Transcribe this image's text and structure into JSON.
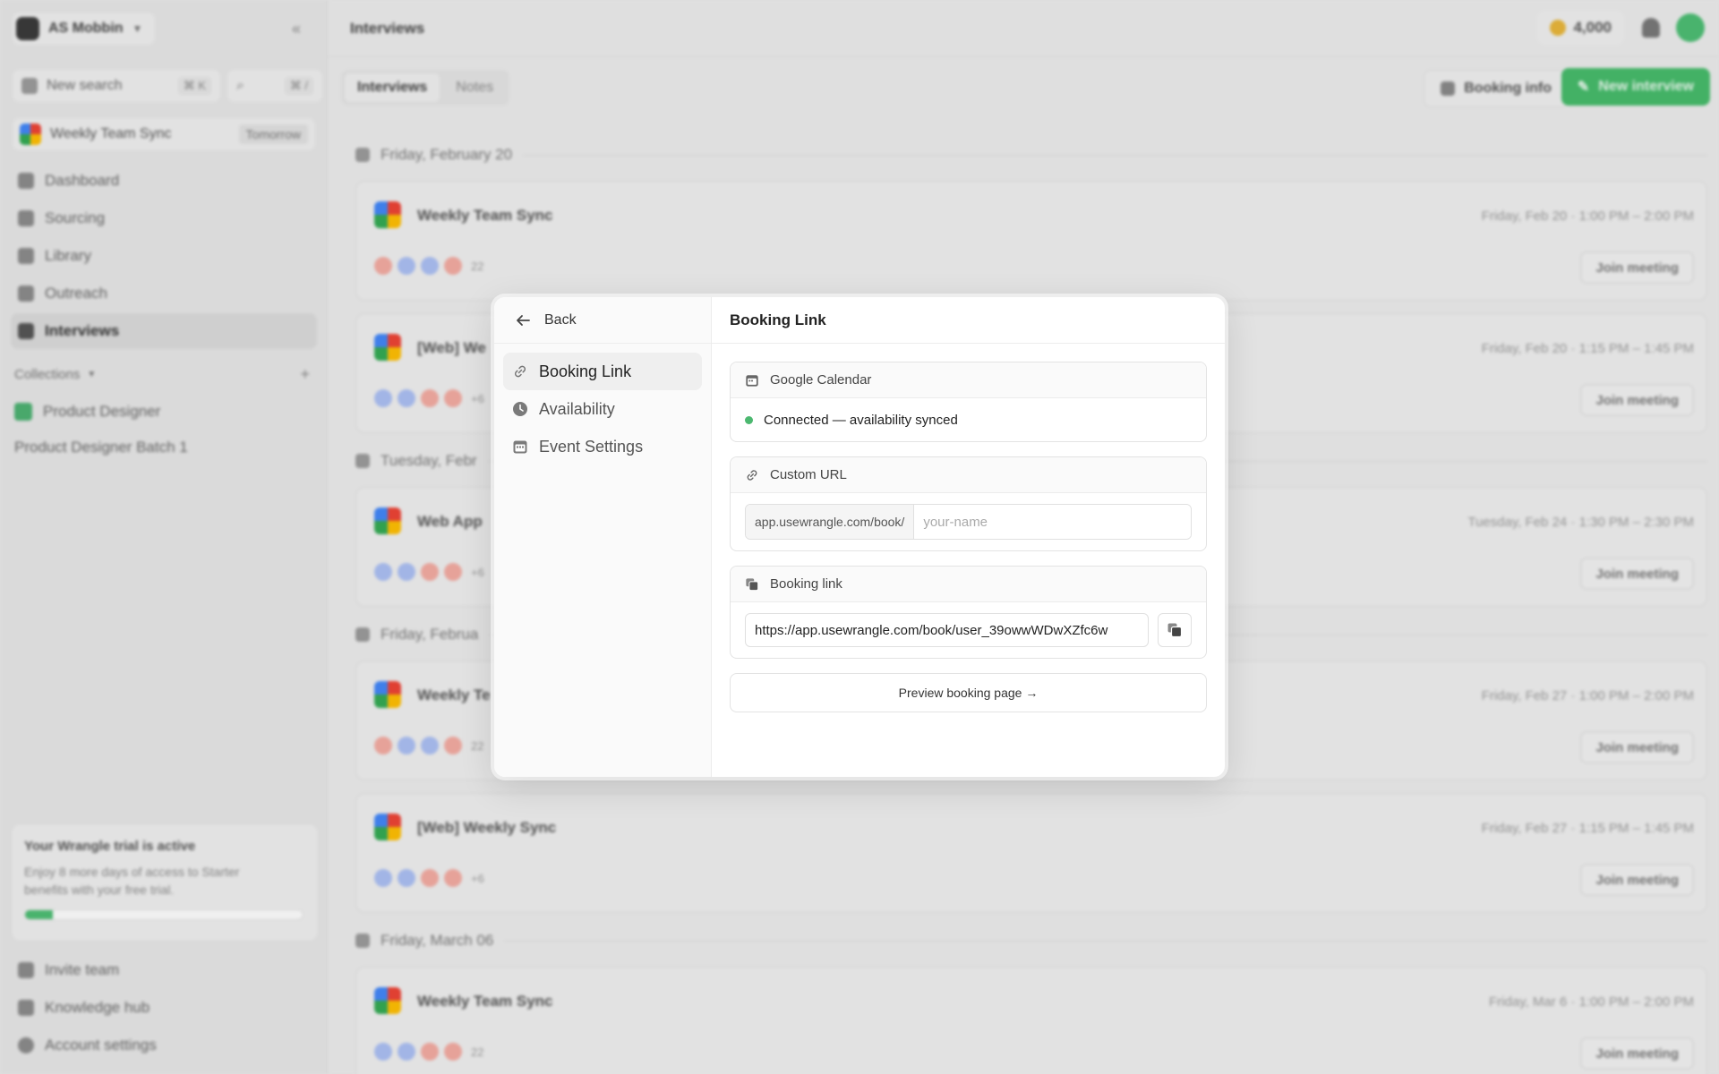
{
  "sidebar": {
    "workspace": "AS Mobbin",
    "new_search": "New search",
    "new_search_kbd": "⌘ K",
    "search_kbd": "⌘ /",
    "upcoming": {
      "title": "Weekly Team Sync",
      "badge": "Tomorrow"
    },
    "nav": [
      "Dashboard",
      "Sourcing",
      "Library",
      "Outreach",
      "Interviews"
    ],
    "collections_label": "Collections",
    "collections": [
      "Product Designer",
      "Product Designer Batch 1"
    ],
    "trial": {
      "title": "Your Wrangle trial is active",
      "text": "Enjoy 8 more days of access to Starter benefits with your free trial.",
      "progress": 0.1
    },
    "bottom_nav": [
      "Invite team",
      "Knowledge hub",
      "Account settings"
    ]
  },
  "topbar": {
    "title": "Interviews",
    "credits": "4,000"
  },
  "subbar": {
    "tabs": [
      "Interviews",
      "Notes"
    ],
    "booking_info": "Booking info",
    "new_interview": "New interview"
  },
  "feed": {
    "days": [
      {
        "label": "Friday, February 20",
        "events": [
          {
            "title": "Weekly Team Sync",
            "time": "Friday, Feb 20 · 1:00 PM – 2:00 PM",
            "more": "22",
            "join": "Join meeting"
          },
          {
            "title": "[Web] We",
            "time": "Friday, Feb 20 · 1:15 PM – 1:45 PM",
            "more": "+6",
            "join": "Join meeting"
          }
        ]
      },
      {
        "label": "Tuesday, Febr",
        "events": [
          {
            "title": "Web App",
            "time": "Tuesday, Feb 24 · 1:30 PM – 2:30 PM",
            "more": "+6",
            "join": "Join meeting"
          }
        ]
      },
      {
        "label": "Friday, Februa",
        "events": [
          {
            "title": "Weekly Te",
            "time": "Friday, Feb 27 · 1:00 PM – 2:00 PM",
            "more": "22",
            "join": "Join meeting"
          },
          {
            "title": "[Web] Weekly Sync",
            "time": "Friday, Feb 27 · 1:15 PM – 1:45 PM",
            "more": "+6",
            "join": "Join meeting"
          }
        ]
      },
      {
        "label": "Friday, March 06",
        "events": [
          {
            "title": "Weekly Team Sync",
            "time": "Friday, Mar 6 · 1:00 PM – 2:00 PM",
            "more": "22",
            "join": "Join meeting"
          }
        ]
      }
    ]
  },
  "modal": {
    "back": "Back",
    "nav": [
      "Booking Link",
      "Availability",
      "Event Settings"
    ],
    "title": "Booking Link",
    "google_calendar": {
      "label": "Google Calendar",
      "status": "Connected — availability synced"
    },
    "custom_url": {
      "label": "Custom URL",
      "prefix": "app.usewrangle.com/book/",
      "placeholder": "your-name"
    },
    "booking_link": {
      "label": "Booking link",
      "value": "https://app.usewrangle.com/book/user_39owwWDwXZfc6w"
    },
    "preview": "Preview booking page →"
  },
  "colors": {
    "accent_green": "#46b96a",
    "status_green": "#4cb870"
  }
}
